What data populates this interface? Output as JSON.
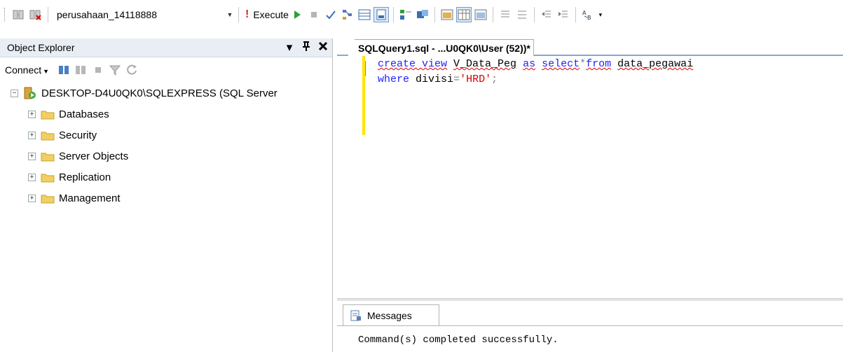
{
  "toolbar": {
    "database": "perusahaan_14118888",
    "execute_label": "Execute",
    "icons": [
      "change-connection-icon",
      "available-databases-icon",
      "execute-icon",
      "debug-icon",
      "cancel-icon",
      "parse-icon",
      "estimated-plan-icon",
      "results-to-icon",
      "query-options-icon",
      "intellisense-icon",
      "include-plan-icon",
      "include-stats-icon",
      "comment-icon",
      "uncomment-icon",
      "decrease-indent-icon",
      "increase-indent-icon",
      "specify-values-icon"
    ]
  },
  "object_explorer": {
    "title": "Object Explorer",
    "connect_label": "Connect",
    "server": "DESKTOP-D4U0QK0\\SQLEXPRESS (SQL Server",
    "folders": [
      "Databases",
      "Security",
      "Server Objects",
      "Replication",
      "Management"
    ]
  },
  "editor": {
    "tab_title": "SQLQuery1.sql - ...U0QK0\\User (52))*",
    "line1": {
      "kw1": "create view",
      "name": "V_Data_Peg",
      "kw2": "as",
      "kw3": "select",
      "star": "*",
      "kw4": "from",
      "table": "data_pegawai"
    },
    "line2": {
      "kw": "where",
      "col": "divisi",
      "op": "=",
      "value": "'HRD'",
      "end": ";"
    }
  },
  "results": {
    "tab_label": "Messages",
    "message": "Command(s) completed successfully."
  }
}
